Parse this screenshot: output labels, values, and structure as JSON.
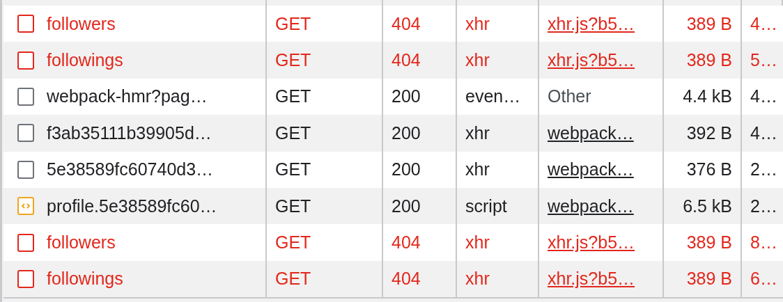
{
  "table": {
    "rows": [
      {
        "name": "followers",
        "kind": "doc",
        "failed": true,
        "method": "GET",
        "status": "404",
        "type": "xhr",
        "initiator": {
          "text": "xhr.js?b5…",
          "link": true
        },
        "size": "389 B",
        "time": "4…"
      },
      {
        "name": "followings",
        "kind": "doc",
        "failed": true,
        "method": "GET",
        "status": "404",
        "type": "xhr",
        "initiator": {
          "text": "xhr.js?b5…",
          "link": true
        },
        "size": "389 B",
        "time": "5…"
      },
      {
        "name": "webpack-hmr?pag…",
        "kind": "doc",
        "failed": false,
        "method": "GET",
        "status": "200",
        "type": "even…",
        "initiator": {
          "text": "Other",
          "link": false
        },
        "size": "4.4 kB",
        "time": "4…"
      },
      {
        "name": "f3ab35111b39905d…",
        "kind": "doc",
        "failed": false,
        "method": "GET",
        "status": "200",
        "type": "xhr",
        "initiator": {
          "text": "webpack…",
          "link": true
        },
        "size": "392 B",
        "time": "4…"
      },
      {
        "name": "5e38589fc60740d3…",
        "kind": "doc",
        "failed": false,
        "method": "GET",
        "status": "200",
        "type": "xhr",
        "initiator": {
          "text": "webpack…",
          "link": true
        },
        "size": "376 B",
        "time": "2…"
      },
      {
        "name": "profile.5e38589fc60…",
        "kind": "code",
        "failed": false,
        "method": "GET",
        "status": "200",
        "type": "script",
        "initiator": {
          "text": "webpack…",
          "link": true
        },
        "size": "6.5 kB",
        "time": "2…"
      },
      {
        "name": "followers",
        "kind": "doc",
        "failed": true,
        "method": "GET",
        "status": "404",
        "type": "xhr",
        "initiator": {
          "text": "xhr.js?b5…",
          "link": true
        },
        "size": "389 B",
        "time": "8…"
      },
      {
        "name": "followings",
        "kind": "doc",
        "failed": true,
        "method": "GET",
        "status": "404",
        "type": "xhr",
        "initiator": {
          "text": "xhr.js?b5…",
          "link": true
        },
        "size": "389 B",
        "time": "6…"
      }
    ]
  }
}
